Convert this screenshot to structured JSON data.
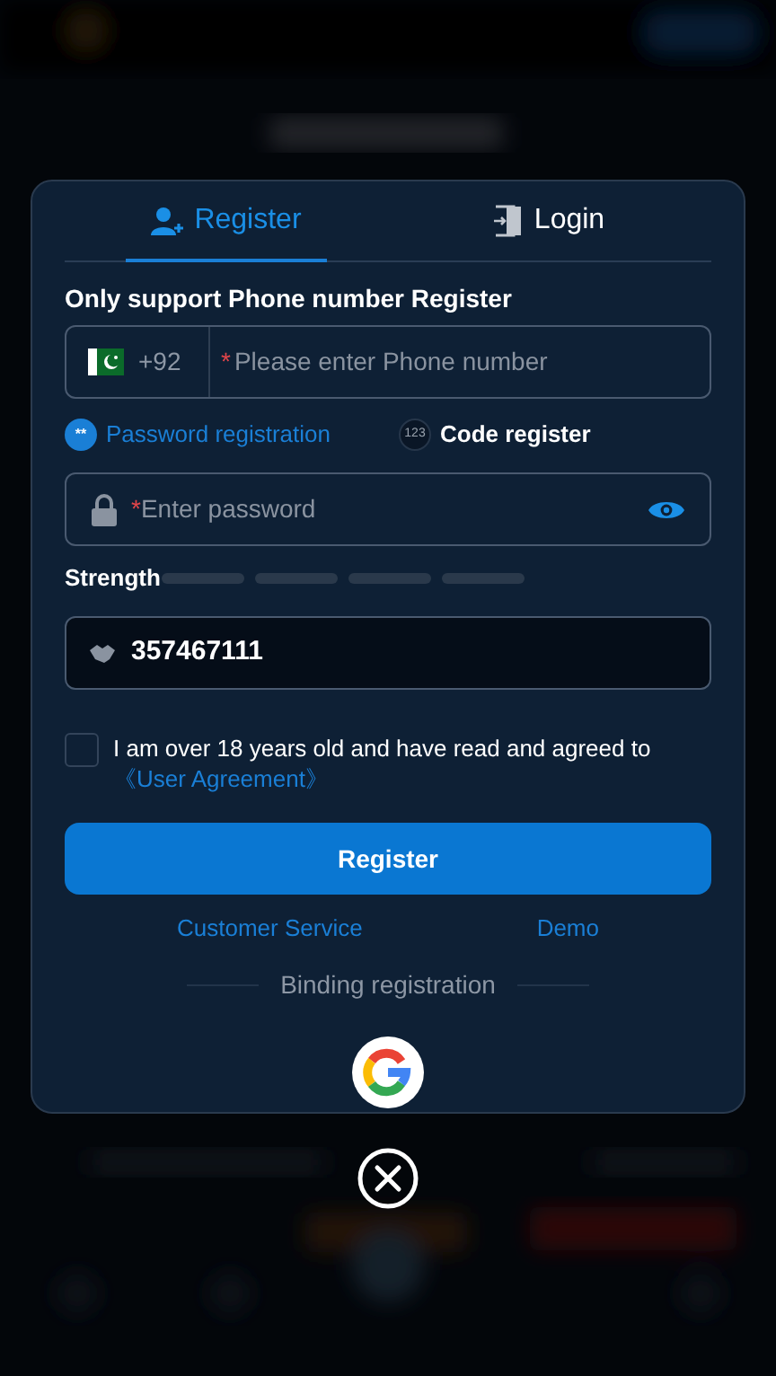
{
  "tabs": [
    {
      "label": "Register",
      "selected": true
    },
    {
      "label": "Login",
      "selected": false
    }
  ],
  "notice": "Only support Phone number Register",
  "phone_field": {
    "country_code": "+92",
    "required_mark": "*",
    "placeholder": "Please enter Phone number"
  },
  "methods": [
    {
      "badge": "**",
      "label": "Password registration",
      "selected": true
    },
    {
      "badge": "123",
      "label": "Code register",
      "selected": false
    }
  ],
  "password_field": {
    "required_mark": "*",
    "placeholder": "Enter password"
  },
  "strength": {
    "label": "Strength"
  },
  "invite_field": {
    "value": "357467111"
  },
  "agreement": {
    "checked": false,
    "text": "I am over 18 years old and have read and agreed to",
    "link": "《User Agreement》"
  },
  "submit": "Register",
  "links": [
    "Customer Service",
    "Demo"
  ],
  "binding_label": "Binding registration"
}
